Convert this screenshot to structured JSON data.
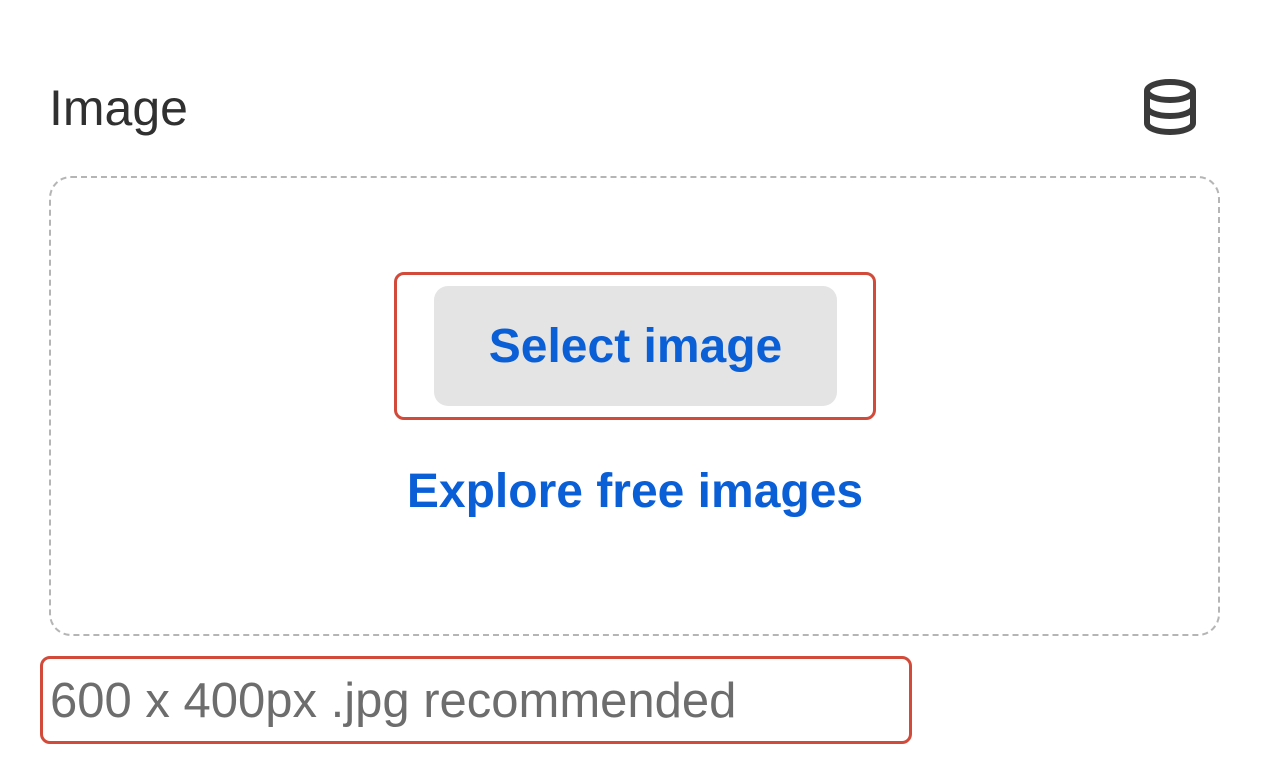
{
  "field": {
    "label": "Image",
    "icon": "database-icon"
  },
  "dropzone": {
    "select_button_label": "Select image",
    "explore_link_label": "Explore free images"
  },
  "hint": "600 x 400px .jpg recommended",
  "colors": {
    "accent": "#0a5fd6",
    "button_bg": "#e4e4e4",
    "highlight": "#d24b3a",
    "label_text": "#303030",
    "hint_text": "#6d6d6d",
    "dashed_border": "#b5b5b5"
  }
}
